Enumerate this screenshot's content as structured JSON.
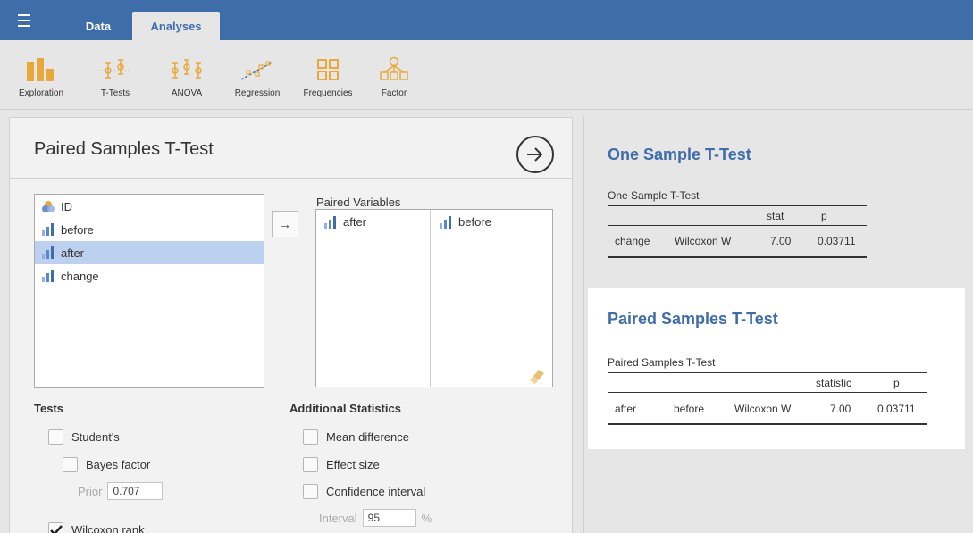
{
  "topbar": {
    "tabs": [
      "Data",
      "Analyses"
    ]
  },
  "ribbon": {
    "items": [
      {
        "label": "Exploration",
        "icon": "exploration-icon"
      },
      {
        "label": "T-Tests",
        "icon": "ttests-icon"
      },
      {
        "label": "ANOVA",
        "icon": "anova-icon"
      },
      {
        "label": "Regression",
        "icon": "regression-icon"
      },
      {
        "label": "Frequencies",
        "icon": "frequencies-icon"
      },
      {
        "label": "Factor",
        "icon": "factor-icon"
      }
    ]
  },
  "options_panel": {
    "title": "Paired Samples T-Test",
    "variables": [
      {
        "name": "ID",
        "type": "nominal"
      },
      {
        "name": "before",
        "type": "continuous"
      },
      {
        "name": "after",
        "type": "continuous",
        "selected": true
      },
      {
        "name": "change",
        "type": "continuous"
      }
    ],
    "paired_label": "Paired Variables",
    "paired": {
      "first": "after",
      "second": "before"
    },
    "move_button": "→",
    "tests_heading": "Tests",
    "tests": {
      "students": "Student's",
      "bayes": "Bayes factor",
      "prior_label": "Prior",
      "prior_value": "0.707",
      "wilcoxon": "Wilcoxon rank"
    },
    "additional_heading": "Additional Statistics",
    "additional": {
      "mean_diff": "Mean difference",
      "effect_size": "Effect size",
      "ci": "Confidence interval",
      "interval_label": "Interval",
      "interval_value": "95",
      "percent": "%"
    }
  },
  "results": {
    "one_sample": {
      "title": "One Sample T-Test",
      "table_title": "One Sample T-Test",
      "headers": [
        "stat",
        "p"
      ],
      "row": [
        "change",
        "Wilcoxon W",
        "7.00",
        "0.03711"
      ]
    },
    "paired": {
      "title": "Paired Samples T-Test",
      "table_title": "Paired Samples T-Test",
      "headers": [
        "statistic",
        "p"
      ],
      "row": [
        "after",
        "before",
        "Wilcoxon W",
        "7.00",
        "0.03711"
      ]
    }
  },
  "colors": {
    "brand_blue": "#3e6da9",
    "selection": "#bcd0ef",
    "highlight_bg": "#ffffff"
  }
}
